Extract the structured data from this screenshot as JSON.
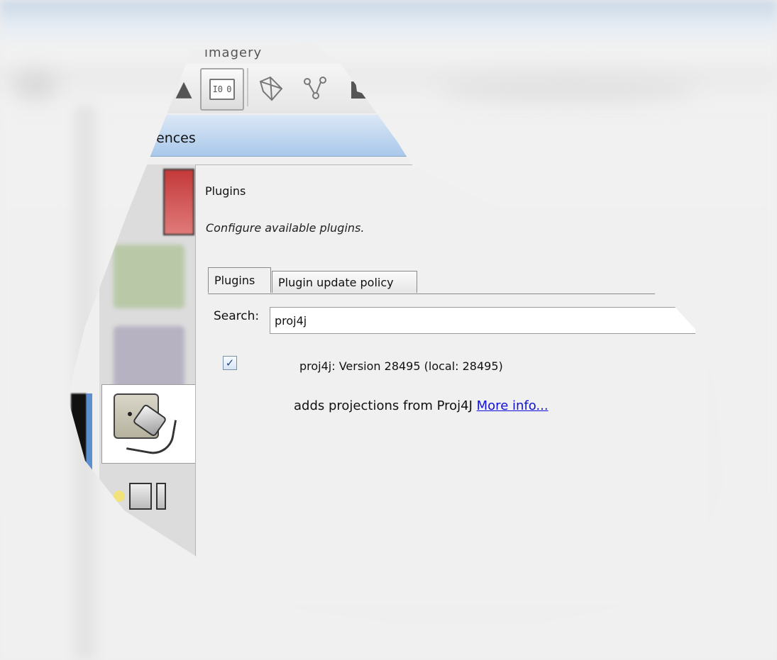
{
  "window": {
    "tab_fragment": "ımagery",
    "title_fragment": "ences"
  },
  "toolbar": {
    "buttons": [
      {
        "icon": "a-toolbar-icon"
      },
      {
        "icon": "preferences-toggle-icon"
      },
      {
        "icon": "wireframe-node-icon"
      },
      {
        "icon": "tree-nodes-icon"
      },
      {
        "icon": "shoe-icon"
      }
    ],
    "active_glyph_left": "I0",
    "active_glyph_right": "0"
  },
  "sidebar": {
    "items": [
      {
        "icon": "display-settings-icon"
      },
      {
        "icon": "globe-icon"
      },
      {
        "icon": "map-grid-icon"
      },
      {
        "icon": "plugin-plug-icon",
        "selected": true
      },
      {
        "icon": "printer-files-icon"
      }
    ]
  },
  "content": {
    "title": "Plugins",
    "description": "Configure available plugins.",
    "tabs": [
      {
        "label": "Plugins",
        "active": true
      },
      {
        "label": "Plugin update policy",
        "active": false
      }
    ],
    "search": {
      "label": "Search:",
      "value": "proj4j"
    },
    "plugin": {
      "checked": true,
      "checkmark": "✓",
      "name": "proj4j: Version 28495 (local: 28495)",
      "description": "adds projections from Proj4J",
      "link": "More info..."
    }
  },
  "colors": {
    "title_bar_gradient_top": "#dbe8f6",
    "title_bar_gradient_bottom": "#a9c8ea",
    "link": "#1010d8"
  }
}
